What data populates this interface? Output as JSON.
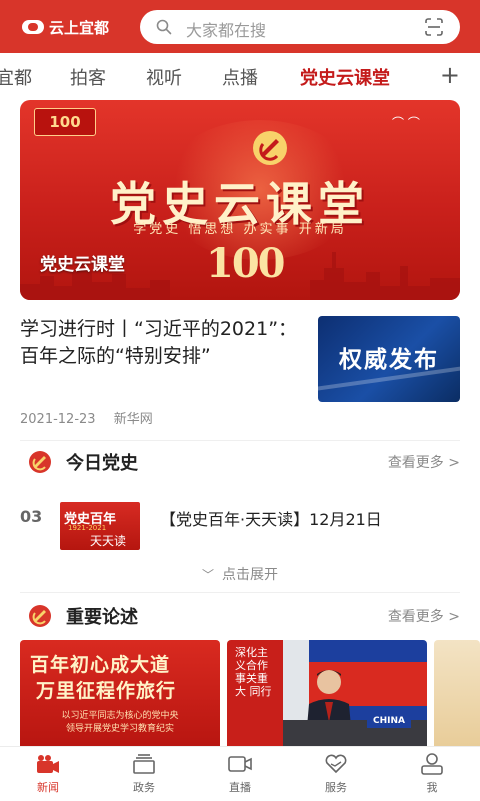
{
  "header": {
    "app_name": "云上宜都",
    "search_placeholder": "大家都在搜"
  },
  "tabs": [
    {
      "label": "宜都",
      "active": false
    },
    {
      "label": "拍客",
      "active": false
    },
    {
      "label": "视听",
      "active": false
    },
    {
      "label": "点播",
      "active": false
    },
    {
      "label": "党史云课堂",
      "active": true
    }
  ],
  "banner": {
    "title": "党史云课堂",
    "slogan": "学党史 悟思想 办实事 开新局",
    "anniversary": "100",
    "caption": "党史云课堂"
  },
  "news": {
    "headline": "学习进行时丨“习近平的2021”：百年之际的“特别安排”",
    "thumb_text": "权威发布",
    "date": "2021-12-23",
    "source": "新华网"
  },
  "section_today": {
    "title": "今日党史",
    "more": "查看更多 >",
    "item": {
      "number": "03",
      "image_text": "党史百年",
      "image_years": "1921-2021",
      "image_subtitle": "天天读",
      "title": "【党史百年·天天读】12月21日"
    },
    "expand": "点击展开"
  },
  "section_remarks": {
    "title": "重要论述",
    "more": "查看更多 >",
    "card1": {
      "line1": "百年初心成大道",
      "line2": "万里征程作旅行",
      "line3": "以习近平同志为核心的党中央\n领导开展党史学习教育纪实"
    },
    "card2": {
      "strip_text": "深化主义合作 事关重大 同行",
      "badge": "CHINA"
    }
  },
  "bottom_nav": [
    {
      "label": "新闻",
      "icon": "camera-icon",
      "active": true
    },
    {
      "label": "政务",
      "icon": "stack-icon",
      "active": false
    },
    {
      "label": "直播",
      "icon": "video-icon",
      "active": false
    },
    {
      "label": "服务",
      "icon": "heart-hands-icon",
      "active": false
    },
    {
      "label": "我",
      "icon": "user-icon",
      "active": false
    }
  ],
  "colors": {
    "brand_red": "#d8352a",
    "active_tab": "#c41b1b"
  }
}
